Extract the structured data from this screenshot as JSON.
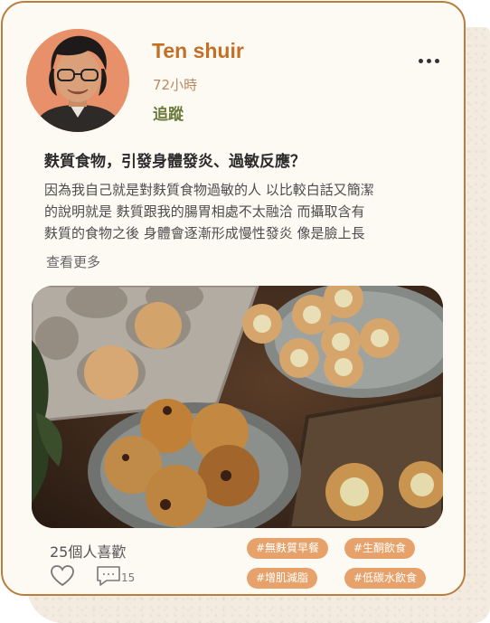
{
  "author": {
    "name": "Ten shuir",
    "time": "72小時",
    "follow_label": "追蹤"
  },
  "post": {
    "title": "麩質食物，引發身體發炎、過敏反應？",
    "lines": [
      "因為我自己就是對麩質食物過敏的人 以比較白話又簡潔",
      "的說明就是 麩質跟我的腸胃相處不太融洽 而攝取含有",
      "麩質的食物之後 身體會逐漸形成慢性發炎 像是臉上長"
    ],
    "see_more": "查看更多"
  },
  "footer": {
    "likes": "25個人喜歡",
    "comment_count": "15"
  },
  "tags": [
    "#無麩質早餐",
    "#生酮飲食",
    "#增肌減脂",
    "#低碳水飲食"
  ],
  "colors": {
    "accent": "#c36f25",
    "follow": "#6a7a3a",
    "tag_bg": "#e6a26a",
    "card_border": "#bb7d3e"
  },
  "icons": [
    "more-icon",
    "heart-icon",
    "comment-icon"
  ]
}
